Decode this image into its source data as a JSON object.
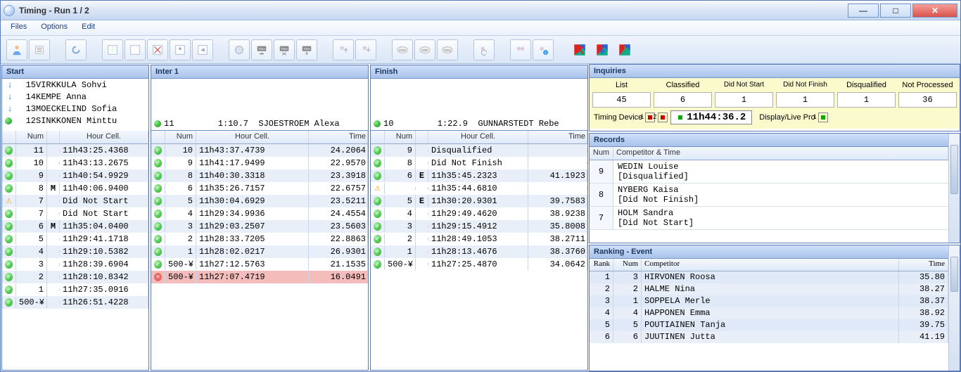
{
  "window": {
    "title": "Timing -   Run 1 / 2"
  },
  "menu": {
    "files": "Files",
    "options": "Options",
    "edit": "Edit"
  },
  "sections": {
    "start": "Start",
    "inter1": "Inter 1",
    "finish": "Finish"
  },
  "headers": {
    "num": "Num",
    "hour": "Hour Cell.",
    "time": "Time"
  },
  "start_upcoming": [
    {
      "icon": "down",
      "num": "15",
      "name": "VIRKKULA Sohvi"
    },
    {
      "icon": "down",
      "num": "14",
      "name": "KEMPE Anna"
    },
    {
      "icon": "down",
      "num": "13",
      "name": "MOECKELIND Sofia"
    },
    {
      "icon": "live",
      "num": "12",
      "name": "SINKKONEN Minttu"
    }
  ],
  "inter_live": {
    "num": "11",
    "time": "1:10.7",
    "name": "SJOESTROEM Alexa"
  },
  "finish_live": {
    "num": "10",
    "time": "1:22.9",
    "name": "GUNNARSTEDT Rebe"
  },
  "start_rows": [
    {
      "s": "ok",
      "num": "11",
      "f": "",
      "hour": "11h43:25.4368"
    },
    {
      "s": "ok",
      "num": "10",
      "f": "",
      "hour": "11h43:13.2675"
    },
    {
      "s": "ok",
      "num": "9",
      "f": "",
      "hour": "11h40:54.9929"
    },
    {
      "s": "ok",
      "num": "8",
      "f": "M",
      "hour": "11h40:06.9400"
    },
    {
      "s": "warn",
      "num": "7",
      "f": "",
      "hour": "Did Not Start"
    },
    {
      "s": "ok",
      "num": "7",
      "f": "",
      "hour": "Did Not Start"
    },
    {
      "s": "ok",
      "num": "6",
      "f": "M",
      "hour": "11h35:04.0400"
    },
    {
      "s": "ok",
      "num": "5",
      "f": "",
      "hour": "11h29:41.1718"
    },
    {
      "s": "ok",
      "num": "4",
      "f": "",
      "hour": "11h29:10.5382"
    },
    {
      "s": "ok",
      "num": "3",
      "f": "",
      "hour": "11h28:39.6904"
    },
    {
      "s": "ok",
      "num": "2",
      "f": "",
      "hour": "11h28:10.8342"
    },
    {
      "s": "ok",
      "num": "1",
      "f": "",
      "hour": "11h27:35.0916"
    },
    {
      "s": "ok",
      "num": "500-¥",
      "f": "",
      "hour": "11h26:51.4228"
    }
  ],
  "inter_rows": [
    {
      "s": "ok",
      "num": "10",
      "hour": "11h43:37.4739",
      "time": "24.2064"
    },
    {
      "s": "ok",
      "num": "9",
      "hour": "11h41:17.9499",
      "time": "22.9570"
    },
    {
      "s": "ok",
      "num": "8",
      "hour": "11h40:30.3318",
      "time": "23.3918"
    },
    {
      "s": "ok",
      "num": "6",
      "hour": "11h35:26.7157",
      "time": "22.6757"
    },
    {
      "s": "ok",
      "num": "5",
      "hour": "11h30:04.6929",
      "time": "23.5211"
    },
    {
      "s": "ok",
      "num": "4",
      "hour": "11h29:34.9936",
      "time": "24.4554"
    },
    {
      "s": "ok",
      "num": "3",
      "hour": "11h29:03.2507",
      "time": "23.5603"
    },
    {
      "s": "ok",
      "num": "2",
      "hour": "11h28:33.7205",
      "time": "22.8863"
    },
    {
      "s": "ok",
      "num": "1",
      "hour": "11h28:02.0217",
      "time": "26.9301"
    },
    {
      "s": "ok",
      "num": "500-¥",
      "hour": "11h27:12.5763",
      "time": "21.1535"
    },
    {
      "s": "x",
      "num": "500-¥",
      "hour": "11h27:07.4719",
      "time": "16.0491",
      "bad": true
    }
  ],
  "finish_rows": [
    {
      "s": "ok",
      "num": "9",
      "f": "",
      "hour": "Disqualified",
      "time": ""
    },
    {
      "s": "ok",
      "num": "8",
      "f": "",
      "hour": "Did Not Finish",
      "time": ""
    },
    {
      "s": "ok",
      "num": "6",
      "f": "E",
      "hour": "11h35:45.2323",
      "time": "41.1923"
    },
    {
      "s": "warn",
      "num": "",
      "f": "",
      "hour": "11h35:44.6810",
      "time": ""
    },
    {
      "s": "ok",
      "num": "5",
      "f": "E",
      "hour": "11h30:20.9301",
      "time": "39.7583"
    },
    {
      "s": "ok",
      "num": "4",
      "f": "",
      "hour": "11h29:49.4620",
      "time": "38.9238"
    },
    {
      "s": "ok",
      "num": "3",
      "f": "",
      "hour": "11h29:15.4912",
      "time": "35.8008"
    },
    {
      "s": "ok",
      "num": "2",
      "f": "",
      "hour": "11h28:49.1053",
      "time": "38.2711"
    },
    {
      "s": "ok",
      "num": "1",
      "f": "",
      "hour": "11h28:13.4676",
      "time": "38.3760"
    },
    {
      "s": "ok",
      "num": "500-¥",
      "f": "",
      "hour": "11h27:25.4870",
      "time": "34.0642"
    }
  ],
  "inquiries": {
    "title": "Inquiries",
    "cols": {
      "list": {
        "label": "List",
        "value": "45"
      },
      "classified": {
        "label": "Classified",
        "value": "6"
      },
      "dns": {
        "label": "Did Not Start",
        "value": "1"
      },
      "dnf": {
        "label": "Did Not Finish",
        "value": "1"
      },
      "dsq": {
        "label": "Disqualified",
        "value": "1"
      },
      "np": {
        "label": "Not Processed",
        "value": "36"
      }
    },
    "timing_device": "Timing Device",
    "display": "Display/Live Pro",
    "clock": "11h44:36.2"
  },
  "records": {
    "title": "Records",
    "headers": {
      "num": "Num",
      "comp": "Competitor & Time"
    },
    "rows": [
      {
        "num": "9",
        "line1": "WEDIN Louise",
        "line2": "[Disqualified]"
      },
      {
        "num": "8",
        "line1": "NYBERG Kaisa",
        "line2": "[Did Not Finish]"
      },
      {
        "num": "7",
        "line1": "HOLM Sandra",
        "line2": "[Did Not Start]"
      }
    ]
  },
  "ranking": {
    "title": "Ranking - Event",
    "headers": {
      "rank": "Rank",
      "num": "Num",
      "comp": "Competitor",
      "time": "Time"
    },
    "rows": [
      {
        "r": "1",
        "n": "3",
        "c": "HIRVONEN Roosa",
        "t": "35.80"
      },
      {
        "r": "2",
        "n": "2",
        "c": "HALME Nina",
        "t": "38.27"
      },
      {
        "r": "3",
        "n": "1",
        "c": "SOPPELA Merle",
        "t": "38.37"
      },
      {
        "r": "4",
        "n": "4",
        "c": "HAPPONEN Emma",
        "t": "38.92"
      },
      {
        "r": "5",
        "n": "5",
        "c": "POUTIAINEN Tanja",
        "t": "39.75"
      },
      {
        "r": "6",
        "n": "6",
        "c": "JUUTINEN Jutta",
        "t": "41.19"
      }
    ]
  }
}
